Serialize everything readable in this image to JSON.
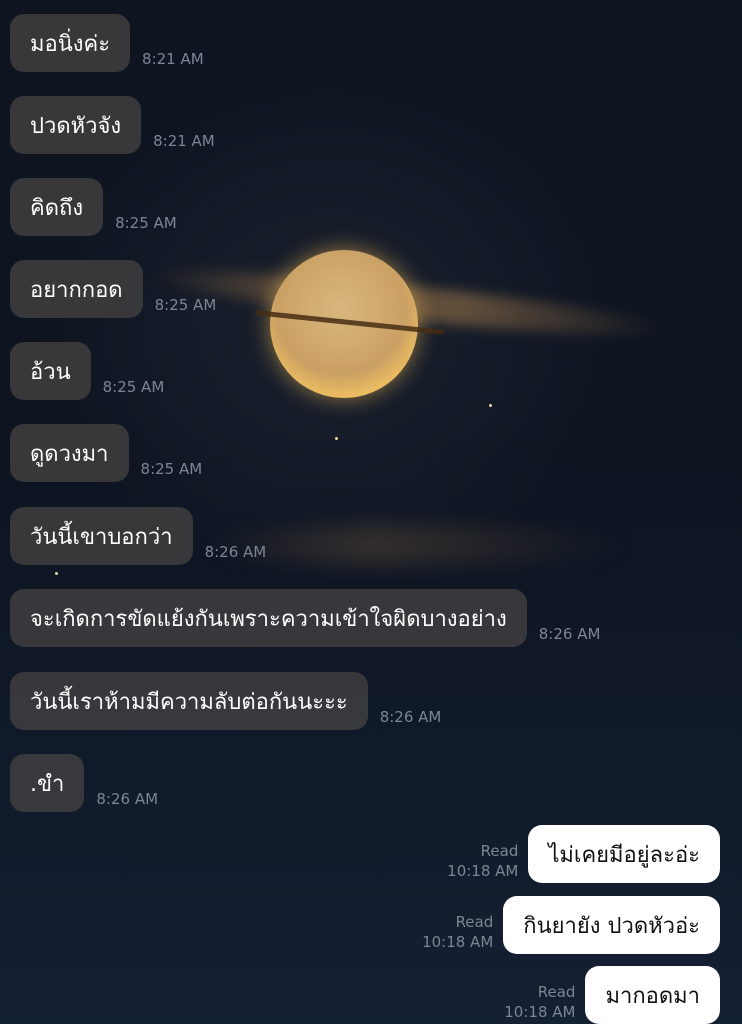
{
  "incoming": [
    {
      "text": "มอนิ่งค่ะ",
      "time": "8:21 AM"
    },
    {
      "text": "ปวดหัวจัง",
      "time": "8:21 AM"
    },
    {
      "text": "คิดถึง",
      "time": "8:25 AM"
    },
    {
      "text": "อยากกอด",
      "time": "8:25 AM"
    },
    {
      "text": "อ้วน",
      "time": "8:25 AM"
    },
    {
      "text": "ดูดวงมา",
      "time": "8:25 AM"
    },
    {
      "text": "วันนี้เขาบอกว่า",
      "time": "8:26 AM"
    },
    {
      "text": "จะเกิดการขัดแย้งกันเพราะความเข้าใจผิดบางอย่าง",
      "time": "8:26 AM"
    },
    {
      "text": "วันนี้เราห้ามมีความลับต่อกันนะะะ",
      "time": "8:26 AM"
    },
    {
      "text": ".ขำ",
      "time": "8:26 AM"
    }
  ],
  "outgoing": [
    {
      "text": "ไม่เคยมีอยู่ละอ่ะ",
      "status": "Read",
      "time": "10:18 AM"
    },
    {
      "text": "กินยายัง  ปวดหัวอ่ะ",
      "status": "Read",
      "time": "10:18 AM"
    },
    {
      "text": "มากอดมา",
      "status": "Read",
      "time": "10:18 AM"
    }
  ]
}
